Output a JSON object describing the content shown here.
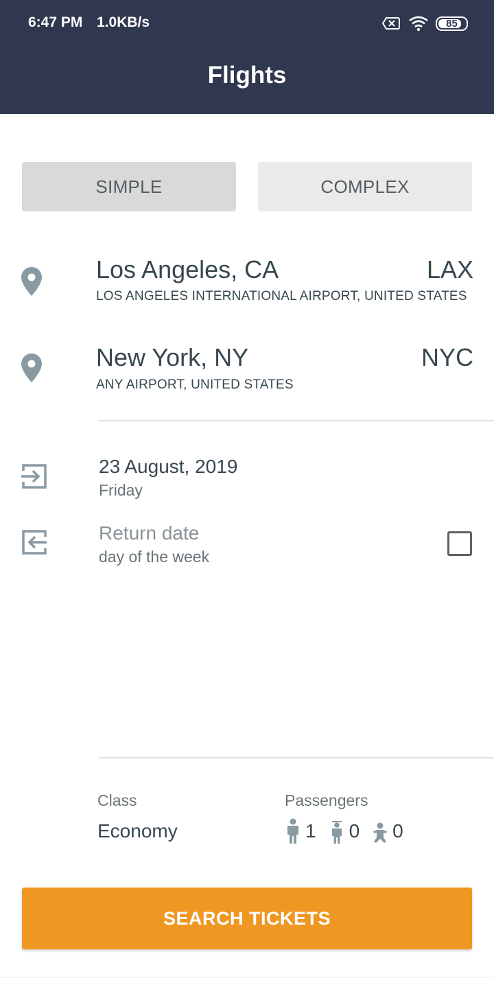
{
  "status_bar": {
    "time": "6:47 PM",
    "speed": "1.0KB/s",
    "battery": "85",
    "battery_level": 0.85
  },
  "header": {
    "title": "Flights"
  },
  "mode_tabs": {
    "simple": "SIMPLE",
    "complex": "COMPLEX",
    "selected": "SIMPLE"
  },
  "origin": {
    "city": "Los Angeles, CA",
    "code": "LAX",
    "airport": "LOS ANGELES INTERNATIONAL AIRPORT, UNITED STATES"
  },
  "destination": {
    "city": "New York, NY",
    "code": "NYC",
    "airport": "ANY AIRPORT, UNITED STATES"
  },
  "departure": {
    "date": "23 August, 2019",
    "weekday": "Friday"
  },
  "return": {
    "date": "Return date",
    "weekday": "day of the week",
    "checked": false
  },
  "travel_class": {
    "label": "Class",
    "value": "Economy"
  },
  "passengers": {
    "label": "Passengers",
    "adults": "1",
    "children": "0",
    "infants": "0"
  },
  "search_button": "SEARCH TICKETS",
  "colors": {
    "app_bar": "#303850",
    "accent": "#ef9723",
    "icon": "#8a9aa3",
    "text": "#37474f"
  },
  "icons": {
    "status": [
      "sim-off-icon",
      "wifi-icon",
      "battery-icon"
    ],
    "locations": "map-pin-icon",
    "departure": "login-arrow-icon",
    "return": "logout-arrow-icon",
    "passengers": [
      "adult-icon",
      "child-icon",
      "infant-icon"
    ]
  }
}
